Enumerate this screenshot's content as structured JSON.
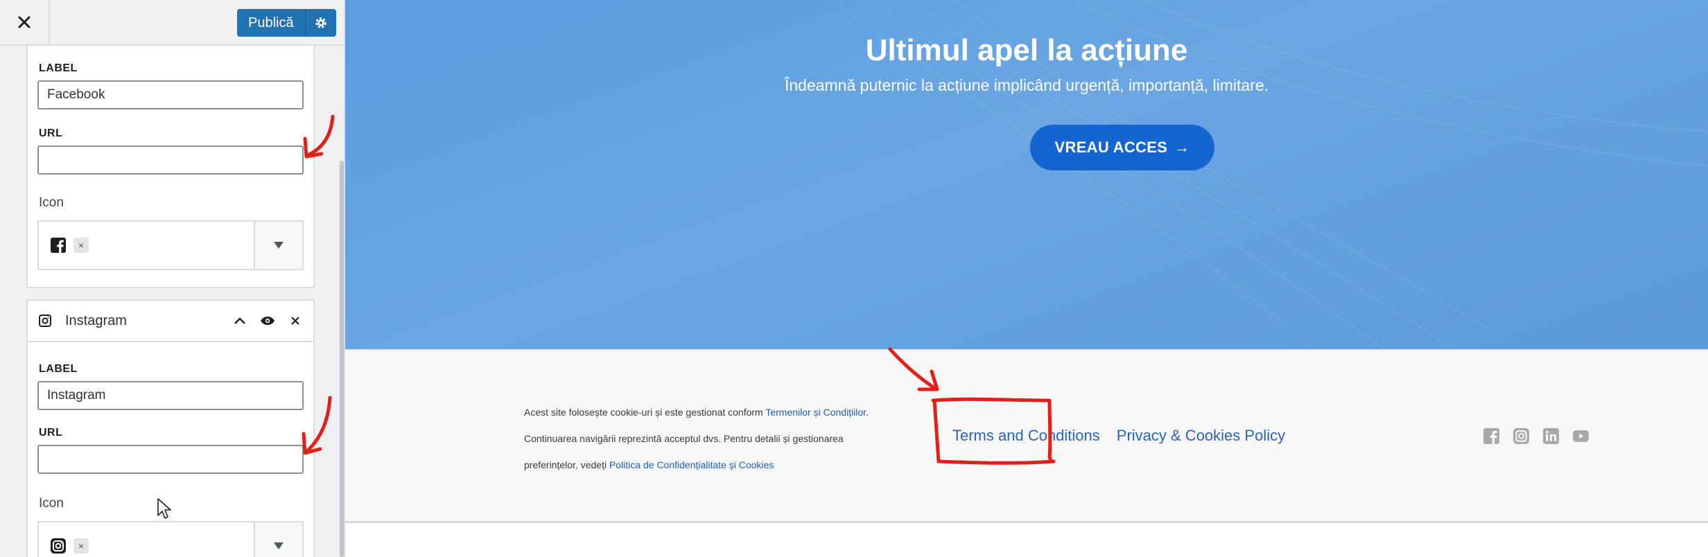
{
  "toolbar": {
    "close_icon": "close-icon",
    "publish_label": "Publică",
    "settings_icon": "gear-icon"
  },
  "facebook_item": {
    "label_caption": "LABEL",
    "label_value": "Facebook",
    "url_caption": "URL",
    "url_value": "",
    "icon_caption": "Icon",
    "icon": "facebook-icon",
    "remove_glyph": "×"
  },
  "instagram_item": {
    "title": "Instagram",
    "label_caption": "LABEL",
    "label_value": "Instagram",
    "url_caption": "URL",
    "url_value": "",
    "icon_caption": "Icon",
    "icon": "instagram-icon",
    "remove_glyph": "×"
  },
  "hero": {
    "title": "Ultimul apel la acțiune",
    "subtitle": "Îndeamnă puternic la acțiune implicând urgență, importanță, limitare.",
    "cta_label": "VREAU ACCES",
    "cta_arrow": "→"
  },
  "footer": {
    "legal_line1_prefix": "Acest site folosește cookie-uri și este gestionat conform ",
    "legal_line1_link": "Termenilor și Condițiilor",
    "legal_line1_suffix": ".",
    "legal_line2": "Continuarea navigării reprezintă acceptul dvs. Pentru detalii și gestionarea",
    "legal_line3_prefix": "preferințelor, vedeți ",
    "legal_line3_link": "Politica de Confidențialitate și Cookies",
    "link_terms": "Terms and Conditions",
    "link_privacy": "Privacy & Cookies Policy",
    "social_icons": [
      "facebook-icon",
      "instagram-icon",
      "linkedin-icon",
      "youtube-icon"
    ]
  },
  "colors": {
    "primary": "#2271b1",
    "hero_blue": "#6aa6e3",
    "cta_blue": "#1465cf",
    "annotation_red": "#e0201a"
  }
}
